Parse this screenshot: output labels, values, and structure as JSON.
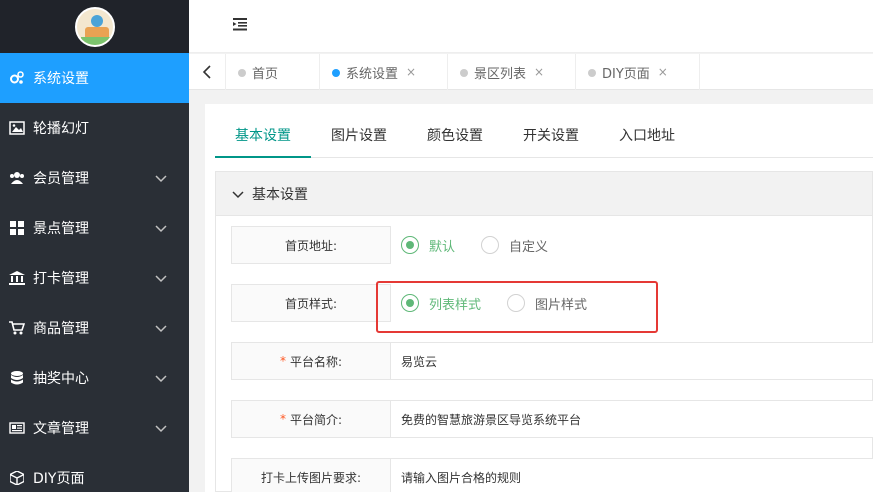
{
  "sidebar": {
    "items": [
      {
        "label": "系统设置",
        "icon": "gears-icon",
        "active": true,
        "has_children": false
      },
      {
        "label": "轮播幻灯",
        "icon": "image-icon",
        "active": false,
        "has_children": false
      },
      {
        "label": "会员管理",
        "icon": "users-icon",
        "active": false,
        "has_children": true
      },
      {
        "label": "景点管理",
        "icon": "grid-icon",
        "active": false,
        "has_children": true
      },
      {
        "label": "打卡管理",
        "icon": "bank-icon",
        "active": false,
        "has_children": true
      },
      {
        "label": "商品管理",
        "icon": "cart-icon",
        "active": false,
        "has_children": true
      },
      {
        "label": "抽奖中心",
        "icon": "database-icon",
        "active": false,
        "has_children": true
      },
      {
        "label": "文章管理",
        "icon": "newspaper-icon",
        "active": false,
        "has_children": true
      },
      {
        "label": "DIY页面",
        "icon": "cube-icon",
        "active": false,
        "has_children": false
      }
    ]
  },
  "tabbar": {
    "tabs": [
      {
        "label": "首页",
        "closable": false,
        "current": false
      },
      {
        "label": "系统设置",
        "closable": true,
        "current": true
      },
      {
        "label": "景区列表",
        "closable": true,
        "current": false
      },
      {
        "label": "DIY页面",
        "closable": true,
        "current": false
      }
    ],
    "close_glyph": "×"
  },
  "content": {
    "sub_tabs": [
      "基本设置",
      "图片设置",
      "颜色设置",
      "开关设置",
      "入口地址"
    ],
    "panel_title": "基本设置",
    "fields": {
      "home_address": {
        "label": "首页地址:",
        "options": [
          "默认",
          "自定义"
        ],
        "selected": 0
      },
      "home_style": {
        "label": "首页样式:",
        "options": [
          "列表样式",
          "图片样式"
        ],
        "selected": 0
      },
      "platform_name": {
        "label": "平台名称:",
        "required": "*",
        "value": "易览云"
      },
      "platform_intro": {
        "label": "平台简介:",
        "required": "*",
        "value": "免费的智慧旅游景区导览系统平台"
      },
      "checkin_requirement": {
        "label": "打卡上传图片要求:",
        "placeholder": "请输入图片合格的规则"
      }
    }
  },
  "colors": {
    "sidebar_bg": "#2a2f36",
    "active_blue": "#1e9fff",
    "accent_green": "#009688",
    "radio_green": "#5fb878",
    "highlight_red": "#e53935"
  }
}
